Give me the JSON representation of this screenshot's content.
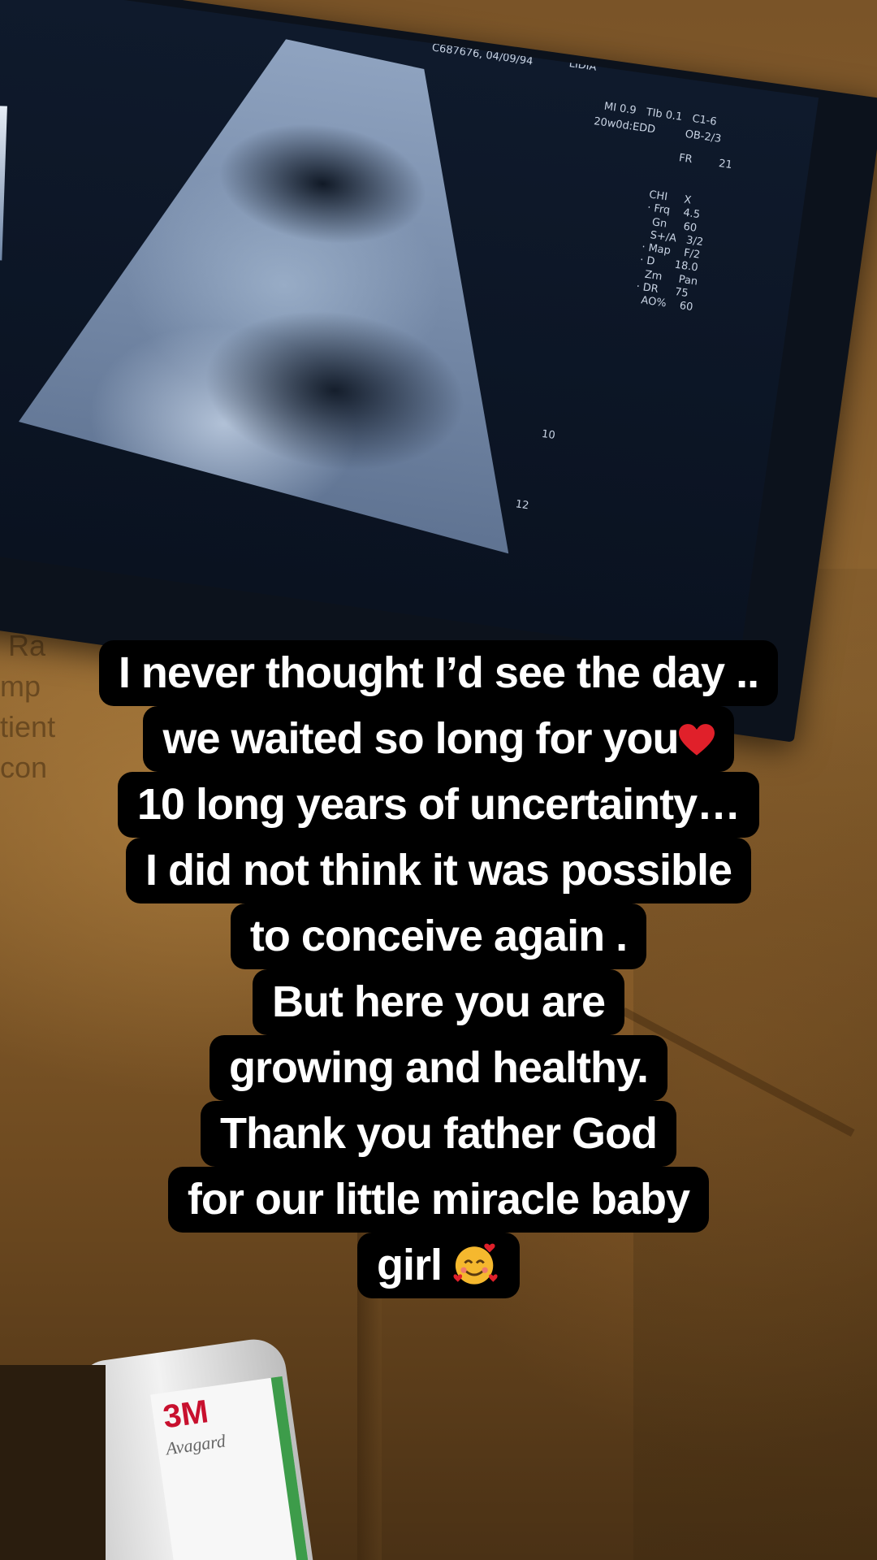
{
  "monitor_text": {
    "top_label": "C687676, 04/09/94",
    "top_tag": "LIDIA",
    "mi_line": "MI 0.9   TIb 0.1   C1-6",
    "edd_line": "20w0d:EDD         OB-2/3",
    "fr_line": "FR        21",
    "params": "CHI     X\n· Frq    4.5\n  Gn     60\n  S+/A   3/2\n· Map    F/2\n· D      18.0\n  Zm     Pan\n· DR     75\n  AO%    60",
    "depth_10": "10",
    "depth_12": "12"
  },
  "poster_text": "n Ra\nemp\natient\n  con",
  "caption": {
    "lines": [
      "I never thought I’d see the day ..",
      "we waited so long for you",
      "10 long years of uncertainty…",
      "I did not think it was possible",
      "to conceive again .",
      "But here you are",
      "growing and healthy.",
      "Thank you father God",
      "for our little miracle baby",
      "girl"
    ],
    "emoji": [
      "red-heart",
      "smiling-face-with-hearts"
    ]
  },
  "bottle": {
    "brand": "3M",
    "product": "Avagard"
  },
  "colors": {
    "caption_bg": "#000000",
    "caption_text": "#ffffff",
    "heart": "#e0202a",
    "emoji_face": "#f5b82e"
  }
}
